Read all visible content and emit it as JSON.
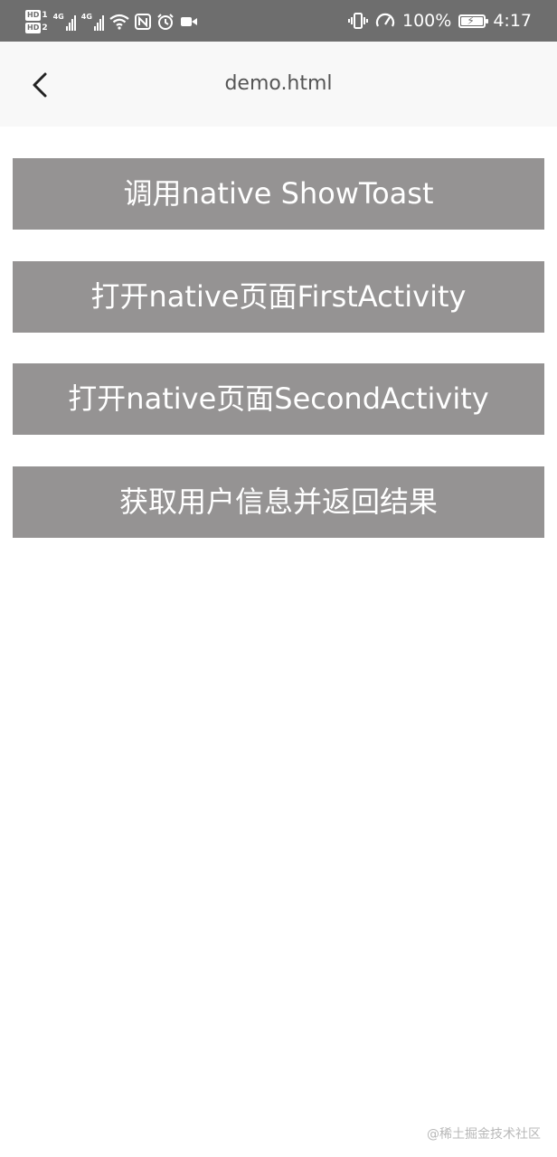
{
  "status_bar": {
    "sim1_label": "HD",
    "sim1_index": "1",
    "sim2_label": "HD",
    "sim2_index": "2",
    "network1": "4G",
    "network2": "4G",
    "battery_percent": "100%",
    "time": "4:17",
    "icons": [
      "signal-icon",
      "wifi-icon",
      "nfc-icon",
      "alarm-icon",
      "video-icon",
      "vibrate-icon",
      "speed-icon",
      "battery-charging-icon"
    ]
  },
  "nav": {
    "title": "demo.html",
    "back_icon": "back-arrow-icon"
  },
  "buttons": [
    {
      "label": "调用native ShowToast"
    },
    {
      "label": "打开native页面FirstActivity"
    },
    {
      "label": "打开native页面SecondActivity"
    },
    {
      "label": "获取用户信息并返回结果"
    }
  ],
  "watermark": "@稀土掘金技术社区",
  "colors": {
    "status_bar_bg": "#6e6e6e",
    "nav_bg": "#f8f8f8",
    "button_bg": "#959393",
    "button_text": "#ffffff"
  }
}
